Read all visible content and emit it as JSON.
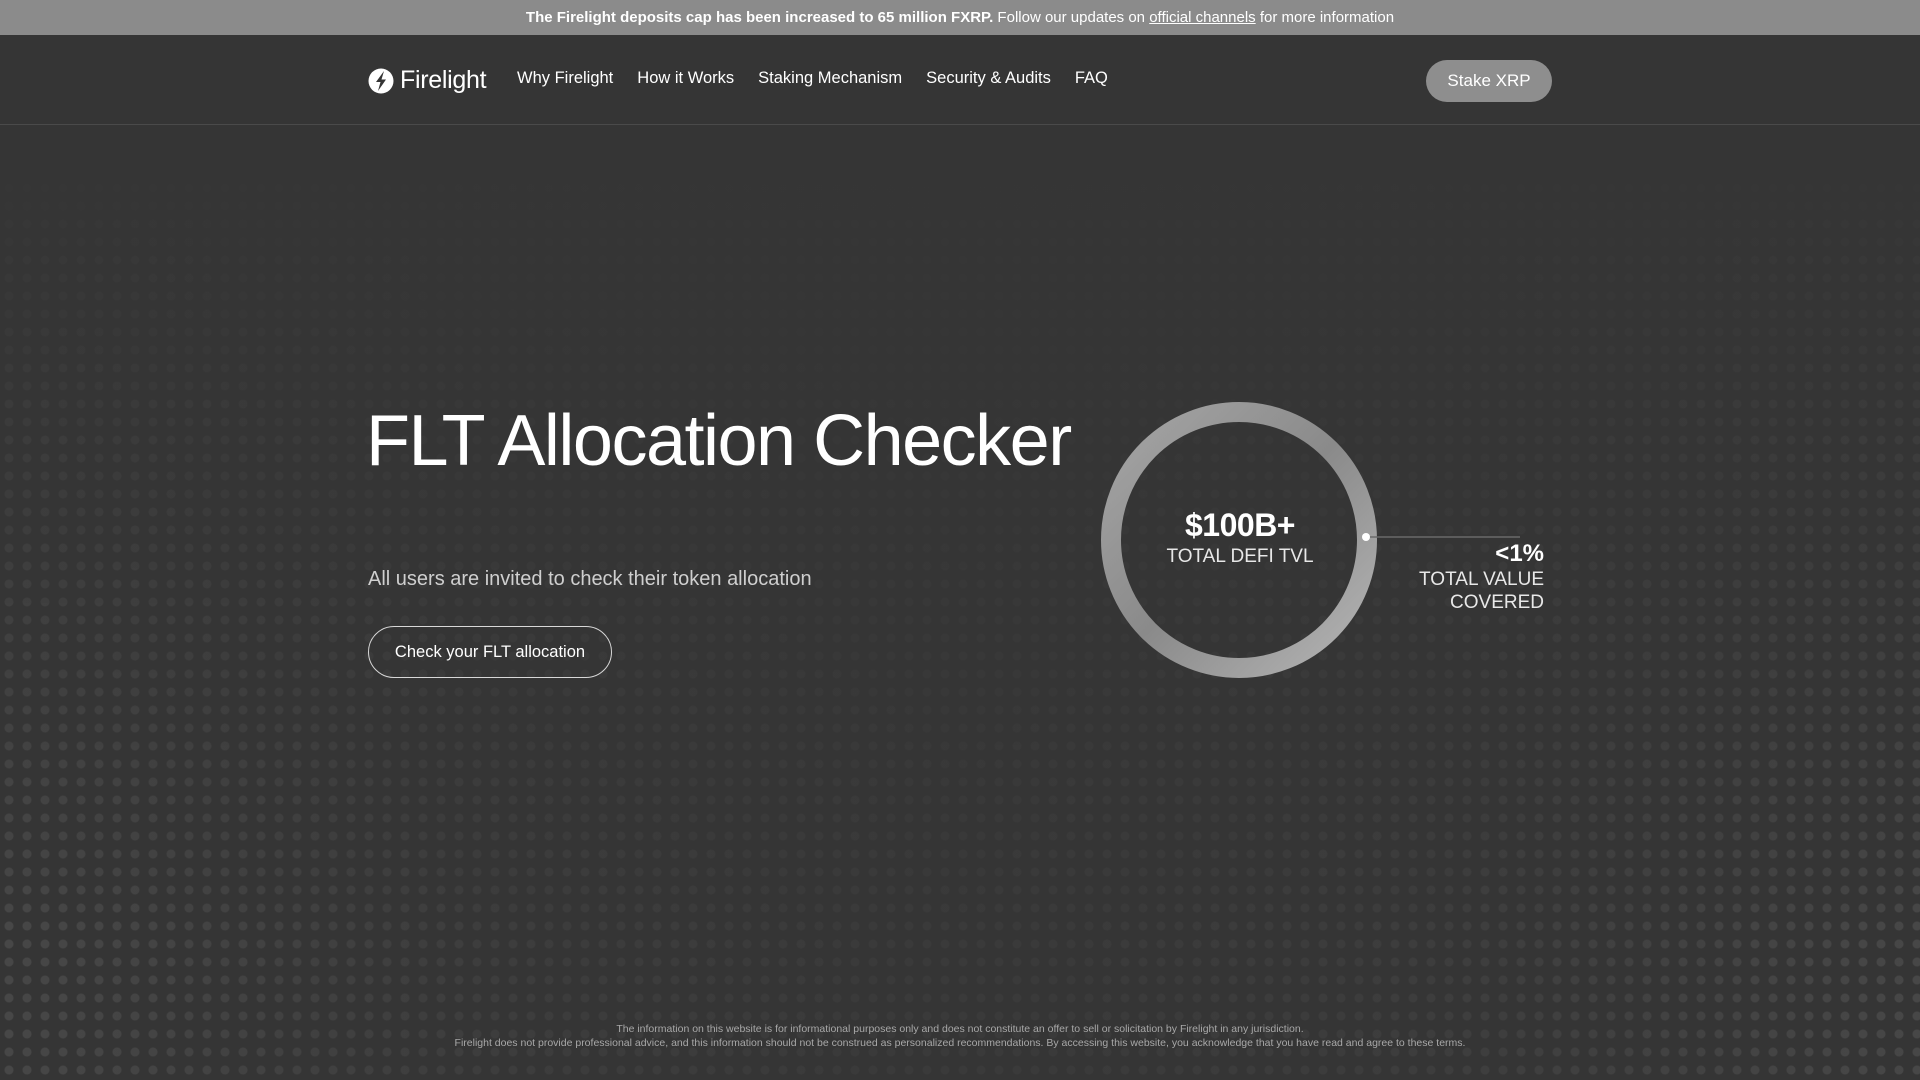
{
  "announcement": {
    "bold_text": "The Firelight deposits cap has been increased to 65 million FXRP.",
    "text_before_link": " Follow our updates on ",
    "link_text": "official channels",
    "text_after_link": " for more information"
  },
  "header": {
    "logo_text": "Firelight",
    "nav": [
      {
        "label": "Why Firelight"
      },
      {
        "label": "How it Works"
      },
      {
        "label": "Staking Mechanism"
      },
      {
        "label": "Security & Audits"
      },
      {
        "label": "FAQ"
      }
    ],
    "stake_button": "Stake XRP"
  },
  "hero": {
    "title": "FLT Allocation Checker",
    "subtitle": "All users are invited to check their token allocation",
    "cta": "Check your FLT allocation"
  },
  "stats": {
    "ring_value": "$100B+",
    "ring_label": "TOTAL DEFI TVL",
    "side_value": "<1%",
    "side_label_line1": "TOTAL VALUE",
    "side_label_line2": "COVERED"
  },
  "footer": {
    "disclaimer_line1": "The information on this website is for informational purposes only and does not constitute an offer to sell or solicitation by Firelight in any jurisdiction.",
    "disclaimer_line2": "Firelight does not provide professional advice, and this information should not be construed as personalized recommendations. By accessing this website, you acknowledge that you have read and agree to these terms."
  },
  "colors": {
    "background": "#353535",
    "announcement_bar": "#8b8b8b",
    "button_fill": "#8e8e8e",
    "text": "#ffffff"
  },
  "icons": {
    "logo": "firelight-flame-logo-icon"
  }
}
